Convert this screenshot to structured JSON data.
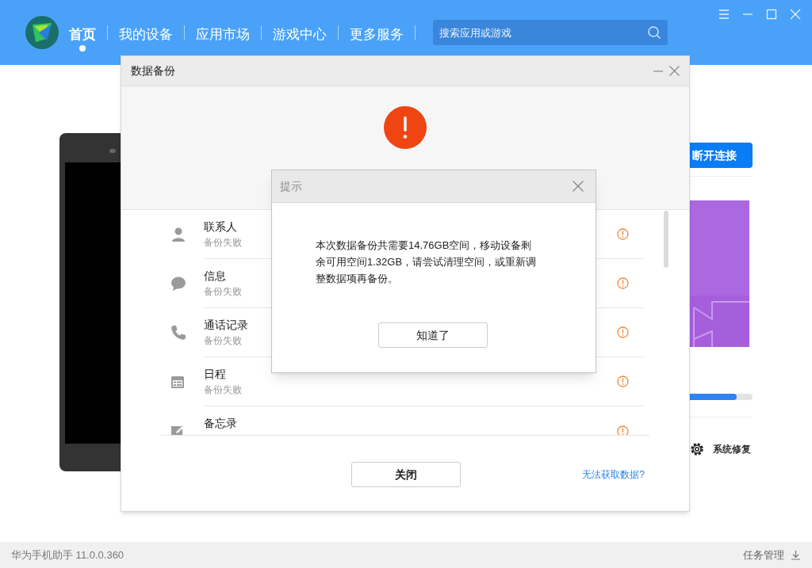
{
  "app_header": {
    "nav": [
      {
        "label": "首页",
        "selected": true
      },
      {
        "label": "我的设备",
        "selected": false
      },
      {
        "label": "应用市场",
        "selected": false
      },
      {
        "label": "游戏中心",
        "selected": false
      },
      {
        "label": "更多服务",
        "selected": false
      }
    ],
    "search": {
      "placeholder": "搜索应用或游戏"
    }
  },
  "background_page": {
    "disconnect_button": "断开连接",
    "progress": {
      "level": 0.77
    },
    "repair_label": "系统修复"
  },
  "backup_dialog": {
    "title": "数据备份",
    "items": [
      {
        "kind": "contacts",
        "name": "联系人",
        "status": "备份失败"
      },
      {
        "kind": "messages",
        "name": "信息",
        "status": "备份失败"
      },
      {
        "kind": "calls",
        "name": "通话记录",
        "status": "备份失败"
      },
      {
        "kind": "calendar",
        "name": "日程",
        "status": "备份失败"
      },
      {
        "kind": "notes",
        "name": "备忘录"
      }
    ],
    "close_button": "关闭",
    "help_link": "无法获取数据?"
  },
  "prompt_dialog": {
    "title": "提示",
    "message": "本次数据备份共需要14.76GB空间，移动设备剩余可用空间1.32GB，请尝试清理空间，或重新调整数据项再备份。",
    "button": "知道了"
  },
  "status_bar": {
    "version": "华为手机助手 11.0.0.360",
    "tasks": "任务管理"
  }
}
